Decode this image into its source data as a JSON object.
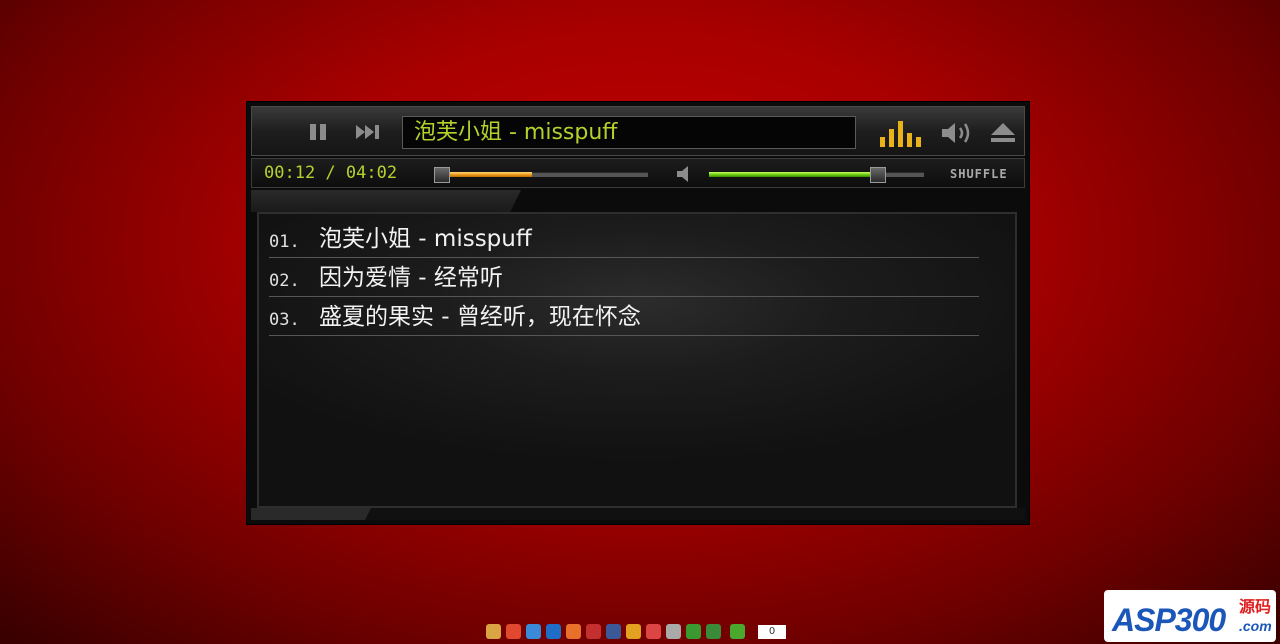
{
  "player": {
    "now_playing": "泡芙小姐 - misspuff",
    "time": "00:12 / 04:02",
    "progress_fraction": 0.46,
    "volume_fraction": 0.75,
    "shuffle_label": "SHUFFLE",
    "icons": {
      "pause": "pause-icon",
      "next": "next-track-icon",
      "equalizer": "equalizer-icon",
      "volume": "volume-icon",
      "eject": "eject-icon",
      "mute": "mute-speaker-icon"
    },
    "colors": {
      "title_text": "#b4d22c",
      "equalizer": "#e9b21b",
      "progress": "#f0a020",
      "volume": "#72cf14"
    }
  },
  "playlist": [
    {
      "num": "01.",
      "title": "泡芙小姐 - misspuff"
    },
    {
      "num": "02.",
      "title": "因为爱情 - 经常听"
    },
    {
      "num": "03.",
      "title": "盛夏的果实 - 曾经听，现在怀念"
    }
  ],
  "share": {
    "count": "0"
  },
  "logo": {
    "main": "ASP300",
    "zh": "源码",
    "com": ".com"
  }
}
